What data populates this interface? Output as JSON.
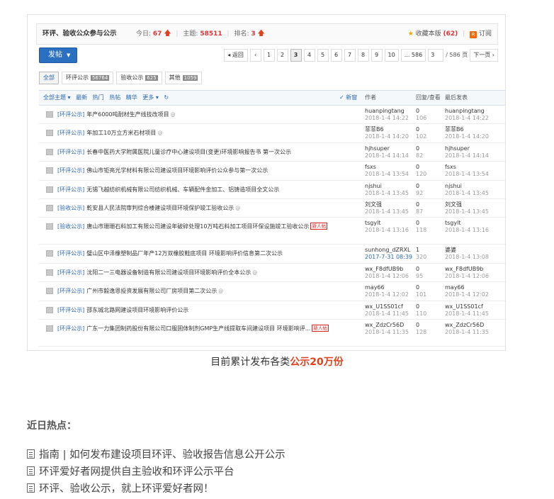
{
  "forum": {
    "title": "环评、验收公众参与公示",
    "today_label": "今日:",
    "today_value": "67",
    "topics_label": "主题:",
    "topics_value": "58511",
    "rank_label": "排名:",
    "rank_value": "3",
    "favorite_label": "收藏本版",
    "favorite_count": "(62)",
    "subscribe_label": "订阅",
    "post_button": "发帖",
    "post_caret": "▼"
  },
  "pagination": {
    "back": "◂ 返回",
    "prev": "‹",
    "pages": [
      "1",
      "2",
      "3",
      "4",
      "5",
      "6",
      "7",
      "8",
      "9",
      "10"
    ],
    "current": "3",
    "last": "... 586",
    "input_value": "3",
    "total": "/ 586 页",
    "next": "下一页 ›"
  },
  "filters": [
    {
      "label": "全部",
      "count": ""
    },
    {
      "label": "环评公示",
      "count": "56764"
    },
    {
      "label": "验收公示",
      "count": "625"
    },
    {
      "label": "其他",
      "count": "1059"
    }
  ],
  "table_header": {
    "options": [
      "全部主题 ▾",
      "最新",
      "热门",
      "热帖",
      "精华",
      "更多 ▾",
      "↻"
    ],
    "new_window": "✓ 新窗",
    "author": "作者",
    "reply_view": "回复/查看",
    "last_post": "最后发表"
  },
  "rows": [
    {
      "cat": "[环评公示]",
      "title": "年产6000吨耐材生产线技改项目",
      "att": "@",
      "tag": "",
      "author": "huanpingtang",
      "date": "2018-1-4 14:22",
      "replies": "0",
      "views": "106",
      "last_user": "huanpingtang",
      "last_date": "2018-1-4 14:22"
    },
    {
      "cat": "[环评公示]",
      "title": "年加工10万立方米石材项目",
      "att": "@",
      "tag": "",
      "author": "菲菲B6",
      "date": "2018-1-4 14:20",
      "replies": "0",
      "views": "102",
      "last_user": "菲菲B6",
      "last_date": "2018-1-4 14:20"
    },
    {
      "cat": "[环评公示]",
      "title": "长春中医药大学附属医院儿童诊疗中心建设项目(变更)环境影响报告书 第一次公示",
      "att": "",
      "tag": "",
      "author": "hjhsuper",
      "date": "2018-1-4 14:14",
      "replies": "0",
      "views": "82",
      "last_user": "hjhsuper",
      "last_date": "2018-1-4 14:14"
    },
    {
      "cat": "[环评公示]",
      "title": "佛山市钜亮光学材料有限公司建设项目环境影响评价公众参与第一次公示",
      "att": "",
      "tag": "",
      "author": "fsxs",
      "date": "2018-1-4 13:54",
      "replies": "0",
      "views": "120",
      "last_user": "fsxs",
      "last_date": "2018-1-4 13:54"
    },
    {
      "cat": "[环评公示]",
      "title": "无锡飞越纺织机械有限公司纺织机械、车辆配件金加工、铝铸造项目全文公示",
      "att": "",
      "tag": "",
      "author": "njshui",
      "date": "2018-1-4 13:45",
      "replies": "0",
      "views": "92",
      "last_user": "njshui",
      "last_date": "2018-1-4 13:45"
    },
    {
      "cat": "[验收公示]",
      "title": "乾安县人民法院审判综合楼建设项目环境保护竣工验收公示",
      "att": "@",
      "tag": "",
      "author": "刘文强",
      "date": "2018-1-4 13:45",
      "replies": "0",
      "views": "87",
      "last_user": "刘文强",
      "last_date": "2018-1-4 13:45"
    },
    {
      "cat": "[验收公示]",
      "title": "唐山市珊珊石料加工有限公司建设年破碎处理10万吨石料加工项目环保设施竣工验收公示",
      "att": "",
      "tag": "新人帖",
      "author": "tsgylt",
      "date": "2018-1-4 13:16",
      "replies": "0",
      "views": "118",
      "last_user": "tsgylt",
      "last_date": "2018-1-4 13:16",
      "tall": true
    },
    {
      "cat": "[环评公示]",
      "title": "璧山区中泽橡塑制品厂年产12万双橡胶鞋底项目 环境影响评价信息第二次公示",
      "att": "",
      "tag": "",
      "author": "sunhong_dZRXL",
      "date": "2017-7-31 08:39",
      "replies": "1",
      "views": "320",
      "last_user": "婆婆",
      "last_date": "2018-1-4 13:08",
      "date_blue": true
    },
    {
      "cat": "[环评公示]",
      "title": "沈阳二一三电器设备制造有限公司建设项目环境影响评价全本公示",
      "att": "@",
      "tag": "",
      "author": "wx_F8dfUB9b",
      "date": "2018-1-4 12:06",
      "replies": "0",
      "views": "95",
      "last_user": "wx_F8dfUB9b",
      "last_date": "2018-1-4 12:06"
    },
    {
      "cat": "[环评公示]",
      "title": "广州市毅逸恩投资发展有限公司厂房项目第二次公示",
      "att": "@",
      "tag": "",
      "author": "may66",
      "date": "2018-1-4 12:02",
      "replies": "0",
      "views": "101",
      "last_user": "may66",
      "last_date": "2018-1-4 12:02"
    },
    {
      "cat": "[环评公示]",
      "title": "邵东城北路网建设项目环境影响评价公示",
      "att": "",
      "tag": "",
      "author": "wx_U1SS01cf",
      "date": "2018-1-4 11:45",
      "replies": "0",
      "views": "110",
      "last_user": "wx_U1SS01cf",
      "last_date": "2018-1-4 11:45"
    },
    {
      "cat": "[环评公示]",
      "title": "广东一力集团制药股份有限公司口服固体制剂GMP生产线提取车间建设项目 环境影响评...",
      "att": "",
      "tag": "新人帖",
      "author": "wx_ZdzCr56D",
      "date": "2018-1-4 11:35",
      "replies": "0",
      "views": "128",
      "last_user": "wx_ZdzCr56D",
      "last_date": "2018-1-4 11:35",
      "tall": true
    }
  ],
  "caption": {
    "prefix": "目前累计发布各类",
    "highlight": "公示20万份"
  },
  "hot": {
    "title": "近日热点：",
    "links": [
      "指南 | 如何发布建设项目环评、验收报告信息公开公示",
      "环评爱好者网提供自主验收和环评公示平台",
      "环评、验收公示，就上环评爱好者网！"
    ]
  },
  "colors": {
    "accent_blue": "#2a66b3",
    "button_blue": "#2a6fc0",
    "highlight_red": "#e0411d",
    "tag_red": "#d22"
  }
}
